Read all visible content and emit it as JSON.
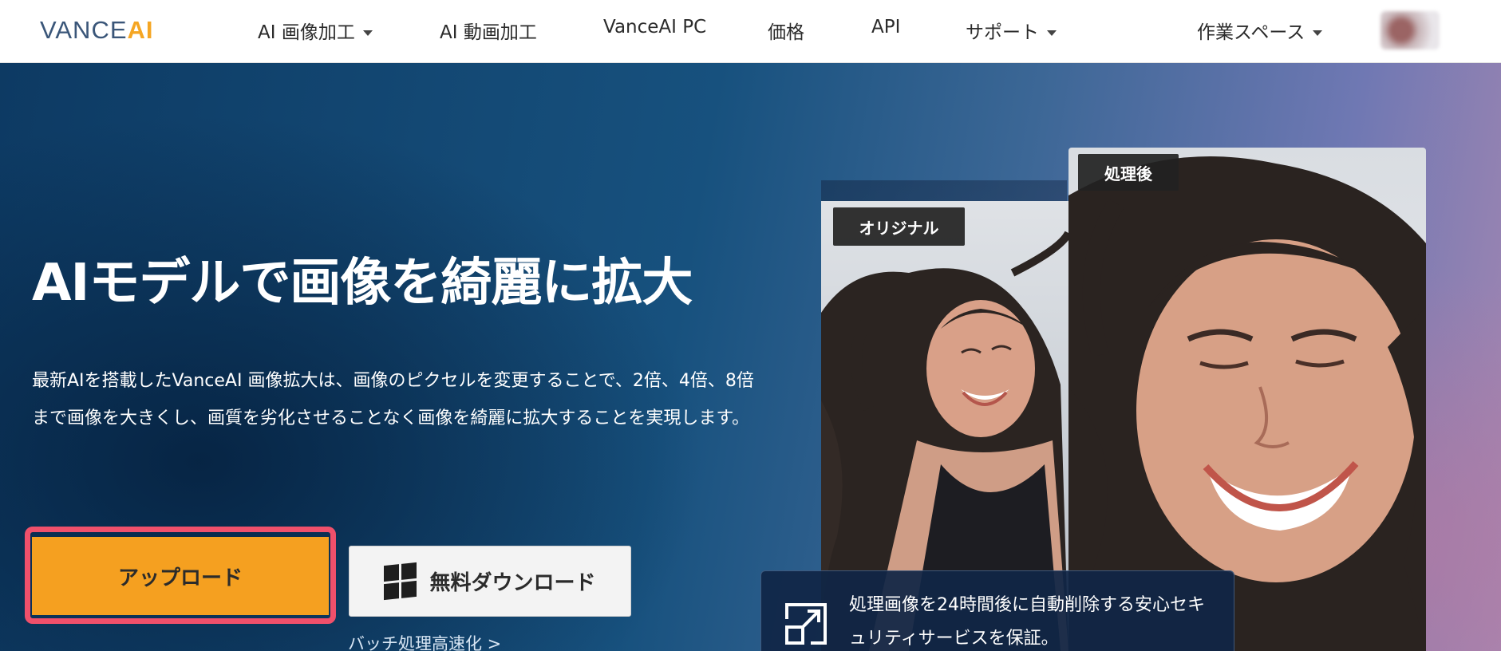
{
  "header": {
    "logo": {
      "part1": "VANCE",
      "part2": "AI"
    },
    "nav": [
      {
        "label": "AI 画像加工",
        "has_dropdown": true
      },
      {
        "label": "AI 動画加工",
        "has_dropdown": false
      },
      {
        "label": "VanceAI PC",
        "has_dropdown": false
      },
      {
        "label": "価格",
        "has_dropdown": false
      },
      {
        "label": "API",
        "has_dropdown": false
      },
      {
        "label": "サポート",
        "has_dropdown": true
      }
    ],
    "workspace": "作業スペース"
  },
  "hero": {
    "title": "AIモデルで画像を綺麗に拡大",
    "description": "最新AIを搭載したVanceAI 画像拡大は、画像のピクセルを変更することで、2倍、4倍、8倍まで画像を大きくし、画質を劣化させることなく画像を綺麗に拡大することを実現します。",
    "upload_button": "アップロード",
    "download_button": "無料ダウンロード",
    "batch_link": "バッチ処理高速化 >",
    "tag_original": "オリジナル",
    "tag_processed": "処理後",
    "security_text": "処理画像を24時間後に自動削除する安心セキュリティサービスを保証。"
  },
  "colors": {
    "accent_orange": "#f5a020",
    "highlight_pink": "#f0506b",
    "logo_blue": "#3a5679",
    "logo_orange": "#f5a623"
  }
}
